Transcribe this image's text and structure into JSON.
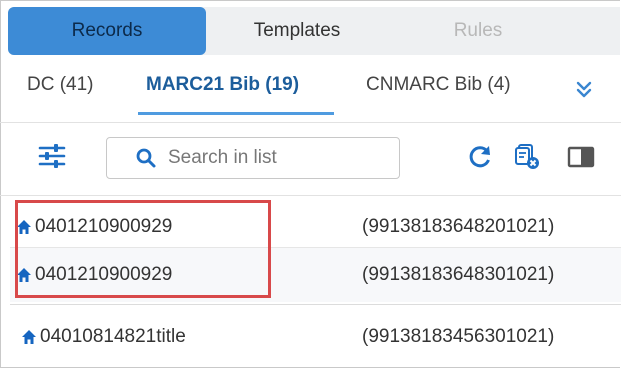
{
  "top_tabs": [
    {
      "label": "Records",
      "active": true
    },
    {
      "label": "Templates",
      "active": false
    },
    {
      "label": "Rules",
      "active": false,
      "disabled": true
    }
  ],
  "sub_tabs": [
    {
      "label": "DC (41)"
    },
    {
      "label": "MARC21 Bib (19)",
      "active": true
    },
    {
      "label": "CNMARC Bib (4)"
    }
  ],
  "toolbar": {
    "search_placeholder": "Search in list",
    "icons": [
      "filter-icon",
      "refresh-icon",
      "clear-selection-icon",
      "panel-toggle-icon"
    ]
  },
  "records": [
    {
      "title": "0401210900929",
      "id": "(99138183648201021)"
    },
    {
      "title": "0401210900929",
      "id": "(99138183648301021)"
    },
    {
      "title": "04010814821title",
      "id": "(99138183456301021)"
    }
  ],
  "colors": {
    "active_tab_bg": "#3d8bd6",
    "active_subtab_text": "#1c5d9b",
    "icon_blue": "#1565c0",
    "highlight_border": "#d8494a"
  }
}
